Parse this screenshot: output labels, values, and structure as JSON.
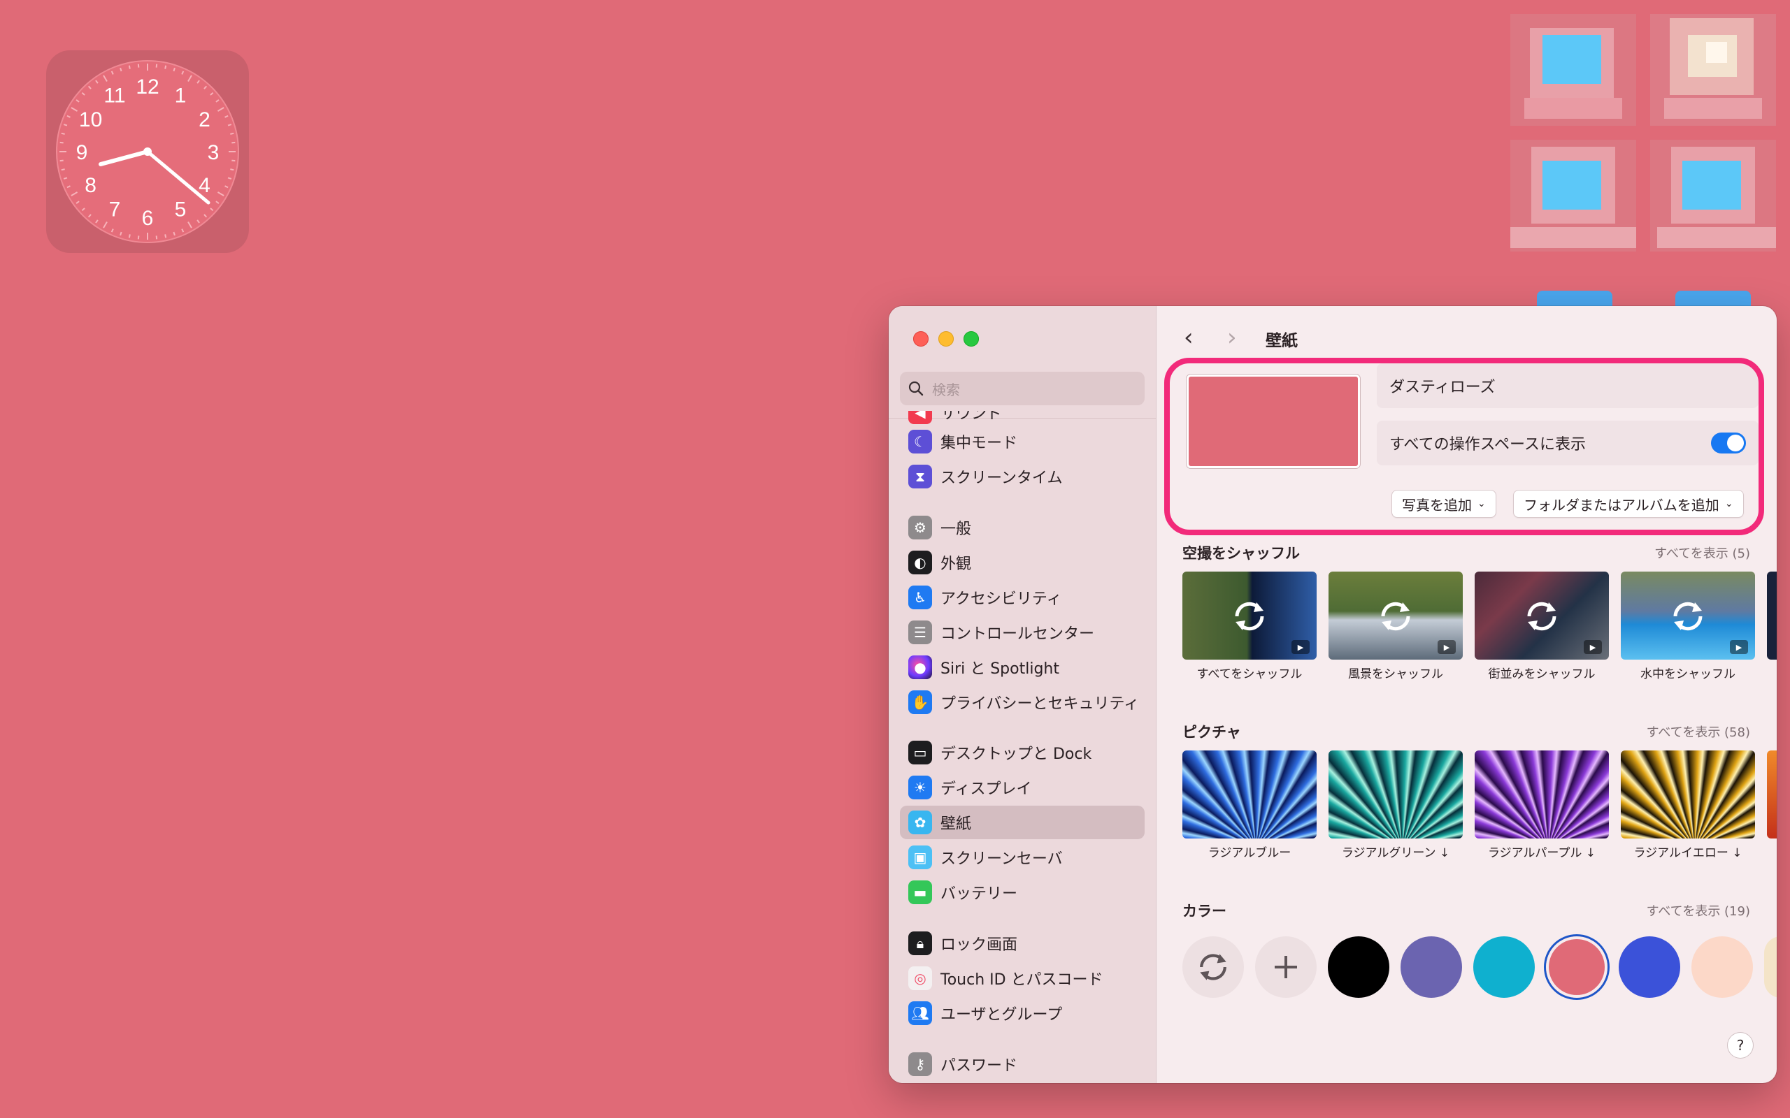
{
  "clock": {
    "numbers": [
      "12",
      "1",
      "2",
      "3",
      "4",
      "5",
      "6",
      "7",
      "8",
      "9",
      "10",
      "11"
    ]
  },
  "window": {
    "title": "壁紙"
  },
  "sidebar": {
    "search_placeholder": "検索",
    "items": [
      {
        "label": "サウンド",
        "icon": "speaker-icon",
        "color": "#f23a4f"
      },
      {
        "label": "集中モード",
        "icon": "moon-icon",
        "color": "#5d4fd6"
      },
      {
        "label": "スクリーンタイム",
        "icon": "hourglass-icon",
        "color": "#5d4fd6"
      },
      {
        "label": "一般",
        "icon": "gear-icon",
        "color": "#8e8a8c"
      },
      {
        "label": "外観",
        "icon": "appearance-icon",
        "color": "#1d1d1f"
      },
      {
        "label": "アクセシビリティ",
        "icon": "accessibility-icon",
        "color": "#1f7af2"
      },
      {
        "label": "コントロールセンター",
        "icon": "control-center-icon",
        "color": "#8e8a8c"
      },
      {
        "label": "Siri と Spotlight",
        "icon": "siri-icon",
        "color": "#3a2a6a"
      },
      {
        "label": "プライバシーとセキュリティ",
        "icon": "hand-icon",
        "color": "#1f7af2"
      },
      {
        "label": "デスクトップと Dock",
        "icon": "dock-icon",
        "color": "#1d1d1f"
      },
      {
        "label": "ディスプレイ",
        "icon": "sun-icon",
        "color": "#1f7af2"
      },
      {
        "label": "壁紙",
        "icon": "flower-icon",
        "color": "#38b6f0"
      },
      {
        "label": "スクリーンセーバ",
        "icon": "screensaver-icon",
        "color": "#4cc0f5"
      },
      {
        "label": "バッテリー",
        "icon": "battery-icon",
        "color": "#34c759"
      },
      {
        "label": "ロック画面",
        "icon": "lock-icon",
        "color": "#1d1d1f"
      },
      {
        "label": "Touch ID とパスコード",
        "icon": "fingerprint-icon",
        "color": "#f4f0f1"
      },
      {
        "label": "ユーザとグループ",
        "icon": "users-icon",
        "color": "#1f7af2"
      },
      {
        "label": "パスワード",
        "icon": "key-icon",
        "color": "#8e8a8c"
      }
    ]
  },
  "current": {
    "name": "ダスティローズ",
    "all_spaces_label": "すべての操作スペースに表示",
    "all_spaces_on": true,
    "add_photo": "写真を追加",
    "add_folder": "フォルダまたはアルバムを追加"
  },
  "aerial": {
    "title": "空撮をシャッフル",
    "show_all": "すべてを表示 (5)",
    "items": [
      {
        "label": "すべてをシャッフル"
      },
      {
        "label": "風景をシャッフル"
      },
      {
        "label": "街並みをシャッフル"
      },
      {
        "label": "水中をシャッフル"
      }
    ]
  },
  "pictures": {
    "title": "ピクチャ",
    "show_all": "すべてを表示 (58)",
    "items": [
      {
        "label": "ラジアルブルー"
      },
      {
        "label": "ラジアルグリーン ↓"
      },
      {
        "label": "ラジアルパープル ↓"
      },
      {
        "label": "ラジアルイエロー ↓"
      }
    ]
  },
  "colors": {
    "title": "カラー",
    "show_all": "すべてを表示 (19)",
    "swatches": [
      "#000000",
      "#6b64b0",
      "#0fb0cf",
      "#e06a77",
      "#3b52d9",
      "#fcd8c8"
    ]
  }
}
